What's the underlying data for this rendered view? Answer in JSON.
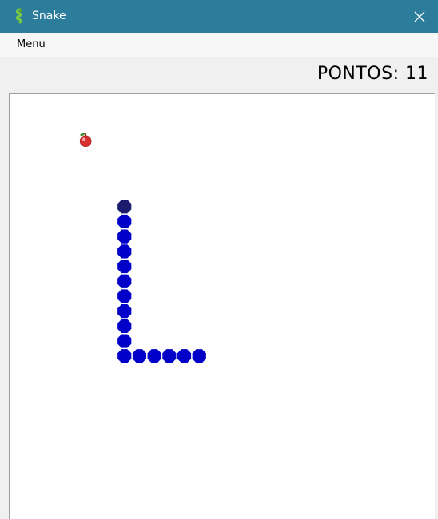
{
  "window": {
    "title": "Snake",
    "icon": "snake-icon",
    "accent_color": "#2c7d9b"
  },
  "menubar": {
    "items": [
      {
        "label": "Menu"
      }
    ]
  },
  "score": {
    "label": "PONTOS: 11"
  },
  "game": {
    "cell_color": "#0000c8",
    "head_color": "#1c1c6e",
    "food": {
      "type": "apple",
      "icon": "apple-icon",
      "color": "#d62f2f"
    },
    "grid_cells": 28,
    "snake": [
      [
        7,
        7
      ],
      [
        7,
        8
      ],
      [
        7,
        9
      ],
      [
        7,
        10
      ],
      [
        7,
        11
      ],
      [
        7,
        12
      ],
      [
        7,
        13
      ],
      [
        7,
        14
      ],
      [
        7,
        15
      ],
      [
        7,
        16
      ],
      [
        7,
        17
      ],
      [
        8,
        17
      ],
      [
        9,
        17
      ],
      [
        10,
        17
      ],
      [
        11,
        17
      ],
      [
        12,
        17
      ]
    ],
    "apple_cell": [
      4,
      2
    ]
  }
}
